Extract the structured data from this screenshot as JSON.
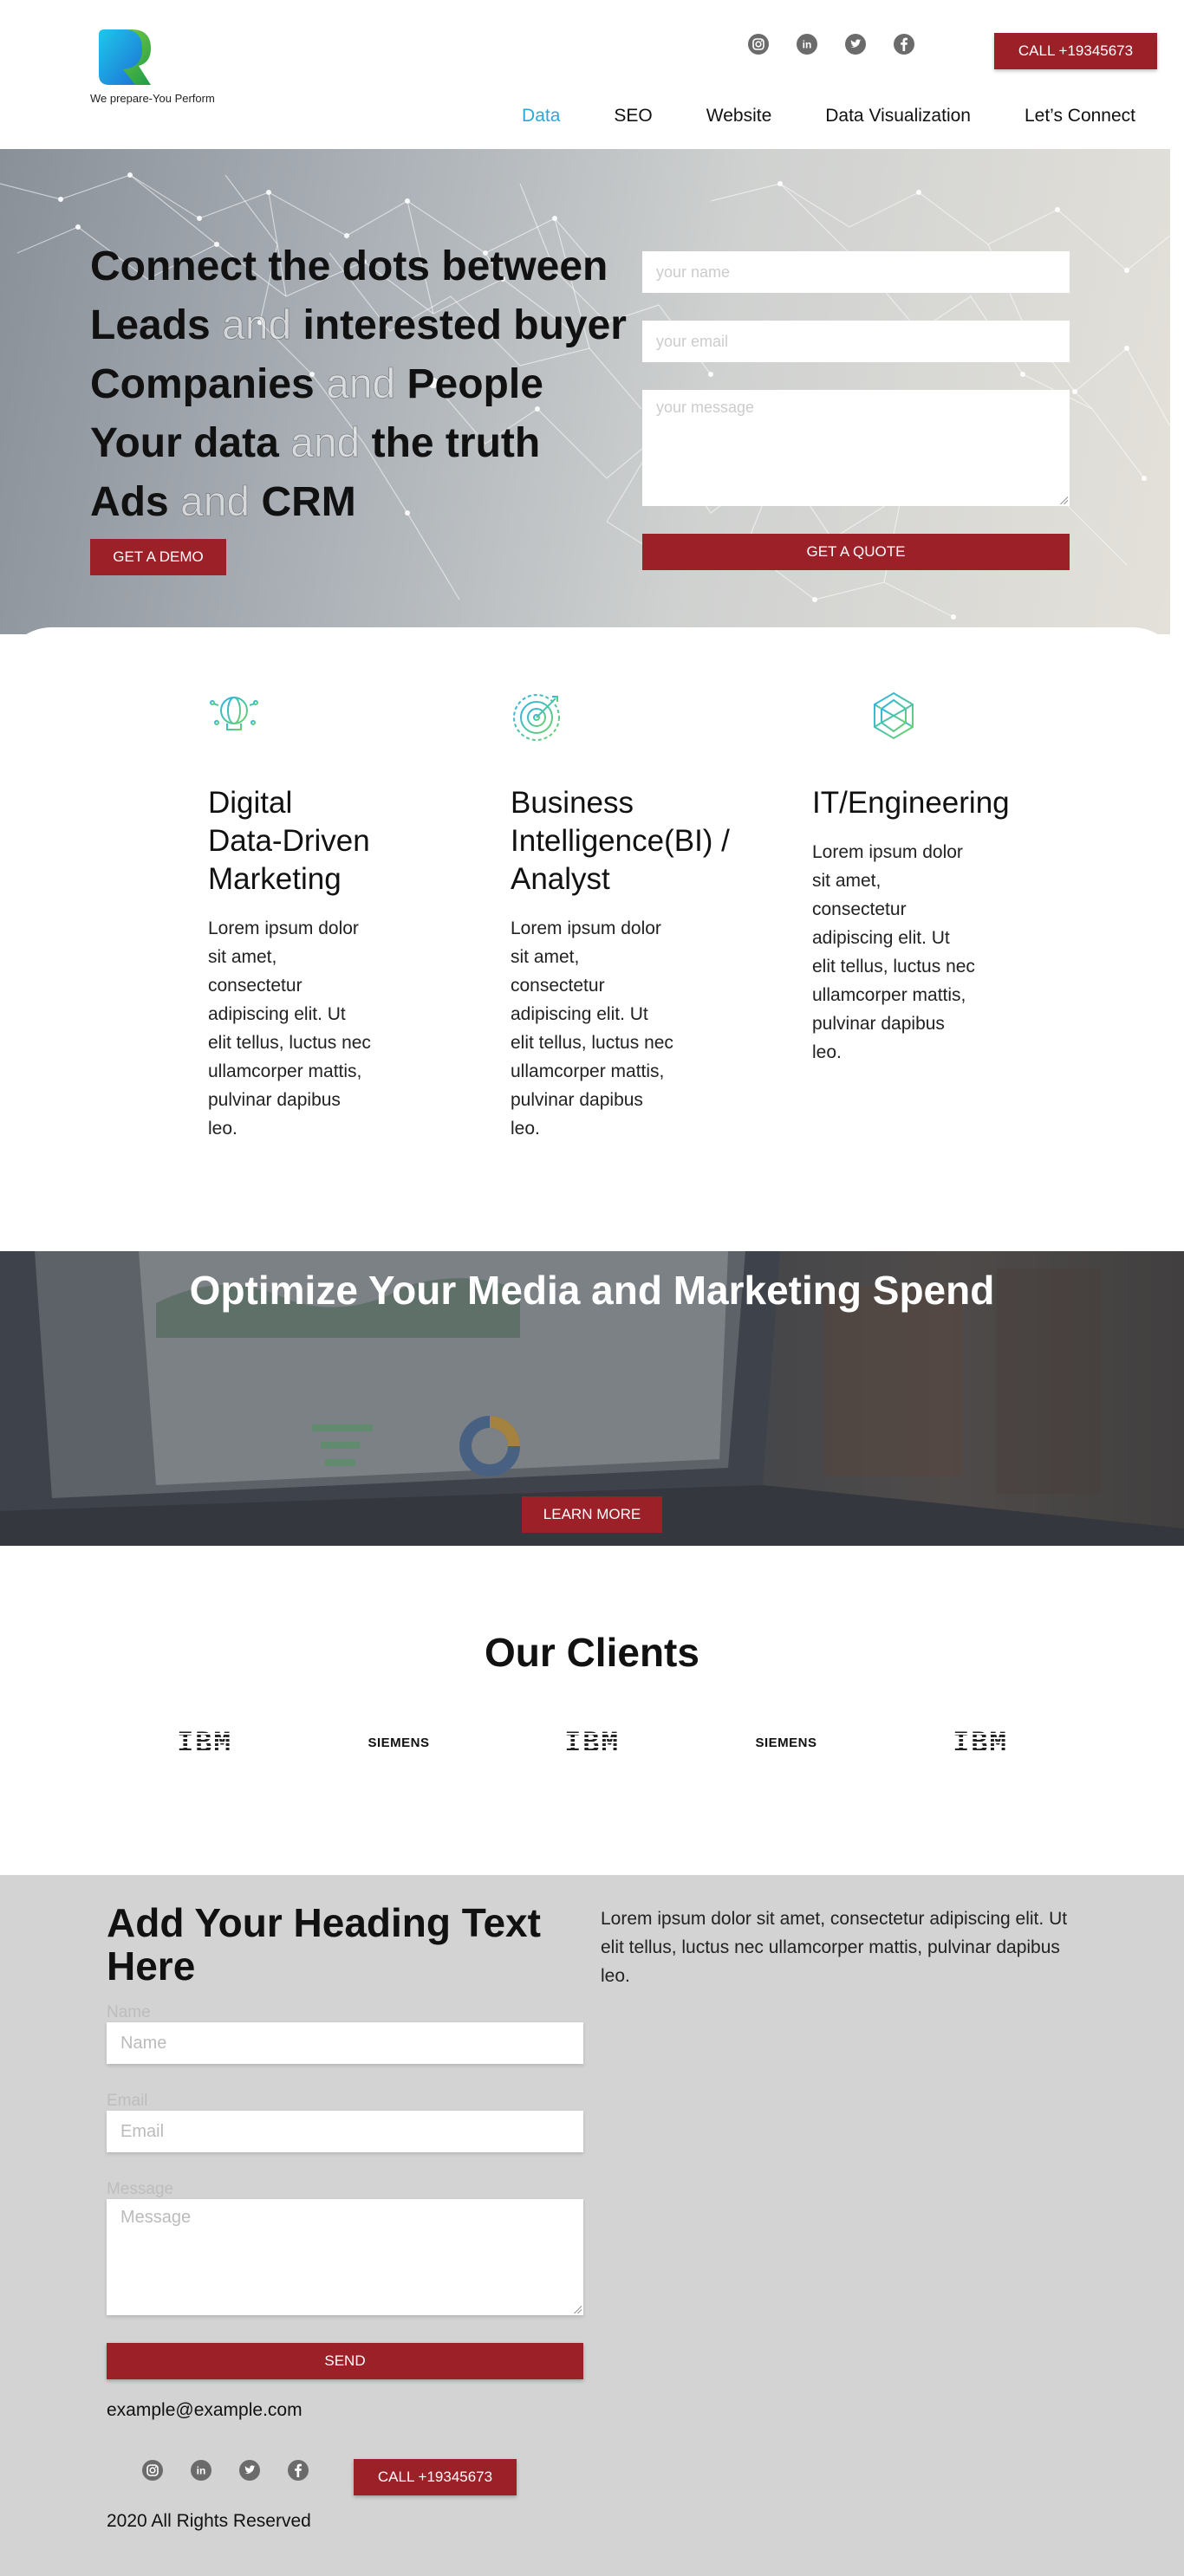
{
  "header": {
    "logo_tagline": "We prepare-You Perform",
    "social": [
      {
        "icon": "instagram-icon"
      },
      {
        "icon": "linkedin-icon"
      },
      {
        "icon": "twitter-icon"
      },
      {
        "icon": "facebook-icon"
      }
    ],
    "call_label": "CALL +19345673",
    "nav": [
      {
        "label": "Data",
        "active": true
      },
      {
        "label": "SEO",
        "active": false
      },
      {
        "label": "Website",
        "active": false
      },
      {
        "label": "Data Visualization",
        "active": false
      },
      {
        "label": "Let’s Connect",
        "active": false
      }
    ]
  },
  "hero": {
    "lines": [
      {
        "a": "Connect the dots between",
        "and": "",
        "b": ""
      },
      {
        "a": "Leads",
        "and": "and",
        "b": "interested buyer"
      },
      {
        "a": "Companies",
        "and": "and",
        "b": "People"
      },
      {
        "a": "Your data",
        "and": "and",
        "b": "the truth"
      },
      {
        "a": "Ads",
        "and": "and",
        "b": "CRM"
      }
    ],
    "demo_label": "GET A DEMO",
    "form": {
      "name_placeholder": "your name",
      "email_placeholder": "your email",
      "message_placeholder": "your message",
      "submit_label": "GET A QUOTE"
    }
  },
  "services": [
    {
      "icon": "globe-icon",
      "title": "Digital Data-Driven Marketing",
      "text": "Lorem ipsum dolor sit amet, consectetur adipiscing elit. Ut elit tellus, luctus nec ullamcorper mattis, pulvinar dapibus leo."
    },
    {
      "icon": "target-icon",
      "title": "Business Intelligence(BI) / Analyst",
      "text": "Lorem ipsum dolor sit amet, consectetur adipiscing elit. Ut elit tellus, luctus nec ullamcorper mattis, pulvinar dapibus leo."
    },
    {
      "icon": "hexagon-network-icon",
      "title": "IT/Engineering",
      "text": "Lorem ipsum dolor sit amet, consectetur adipiscing elit. Ut elit tellus, luctus nec ullamcorper mattis, pulvinar dapibus leo."
    }
  ],
  "banner": {
    "title": "Optimize Your Media and Marketing Spend",
    "button_label": "LEARN MORE"
  },
  "clients": {
    "title": "Our Clients",
    "logos": [
      "IBM",
      "SIEMENS",
      "IBM",
      "SIEMENS",
      "IBM"
    ]
  },
  "contact": {
    "heading": "Add Your Heading Text Here",
    "paragraph": "Lorem ipsum dolor sit amet, consectetur adipiscing elit. Ut elit tellus, luctus nec ullamcorper mattis, pulvinar dapibus leo.",
    "name_label": "Name",
    "name_placeholder": "Name",
    "email_label": "Email",
    "email_placeholder": "Email",
    "message_label": "Message",
    "message_placeholder": "Message",
    "send_label": "SEND",
    "email": "example@example.com",
    "call_label": "CALL +19345673",
    "copyright": "2020 All Rights Reserved"
  },
  "colors": {
    "accent": "#9b2027",
    "nav_active": "#2aa9d6",
    "footer_bg": "#d3d3d3"
  }
}
